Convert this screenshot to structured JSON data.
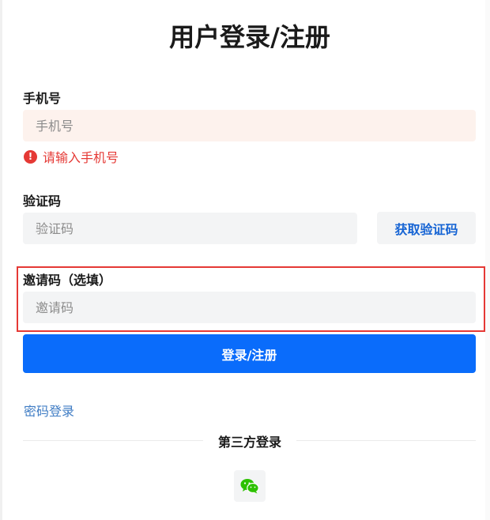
{
  "form": {
    "title": "用户登录/注册",
    "phone": {
      "label": "手机号",
      "placeholder": "手机号",
      "value": "",
      "error": "请输入手机号"
    },
    "code": {
      "label": "验证码",
      "placeholder": "验证码",
      "value": "",
      "get_code_label": "获取验证码"
    },
    "invite": {
      "label": "邀请码（选填）",
      "placeholder": "邀请码",
      "value": ""
    },
    "submit_label": "登录/注册",
    "password_login_link": "密码登录",
    "third_party_label": "第三方登录"
  },
  "icons": {
    "error": "exclamation-circle-icon",
    "third_party": "wechat-icon"
  },
  "colors": {
    "primary": "#0a6cfb",
    "error": "#e53935",
    "link": "#3f7cc4",
    "wechat": "#2dc100",
    "highlight_border": "#e53935"
  }
}
